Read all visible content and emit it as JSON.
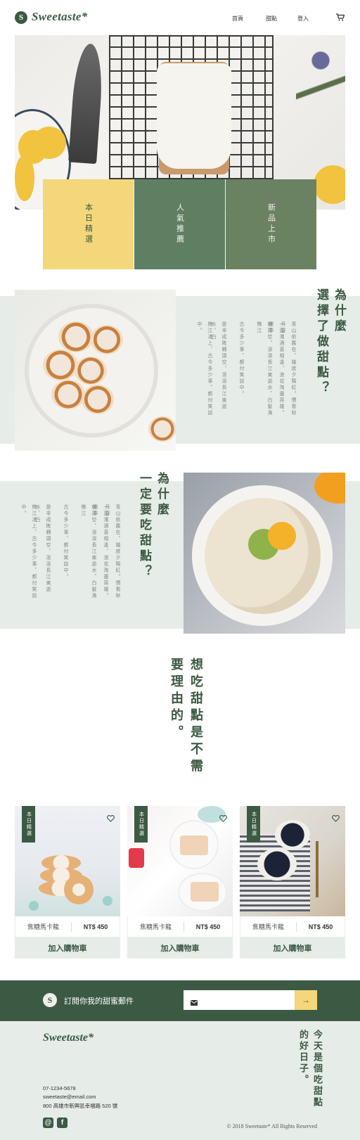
{
  "brand": {
    "name": "Sweetaste*",
    "mark": "S"
  },
  "nav": {
    "items": [
      "首頁",
      "甜點",
      "登入"
    ],
    "cart_icon": "cart-icon"
  },
  "categories": [
    "本日精選",
    "人氣推薦",
    "新品上市"
  ],
  "section_why_choose": {
    "title_lines": [
      "為什麼",
      "選擇了做甜點？"
    ],
    "body_lines": [
      "青山依舊在，幾度夕陽紅。慣看秋月春",
      "一壺濁酒喜相逢，浪花淘盡英雄。是非",
      "轉頭空，滾滾長江東逝水，白髮漁樵江",
      "古今多少事，都付笑談中。",
      "是非成敗轉頭空，滾滾長江東逝水，白",
      "樵江渚上，古今多少事，都付笑談中。"
    ]
  },
  "section_why_eat": {
    "title_lines": [
      "為什麼",
      "一定要吃甜點？"
    ],
    "body_lines": [
      "青山依舊在，幾度夕陽紅。慣看秋月春",
      "一壺濁酒喜相逢，浪花淘盡英雄。是非",
      "轉頭空，滾滾長江東逝水，白髮漁樵江",
      "古今多少事，都付笑談中。",
      "是非成敗轉頭空，滾滾長江東逝水，白",
      "樵江渚上，古今多少事，都付笑談中。"
    ]
  },
  "slogan": {
    "lines": [
      "想吃甜點",
      "是不需要理由的。"
    ]
  },
  "products": [
    {
      "badge": "本日精選",
      "name": "焦糖馬卡龍",
      "price": "NT$ 450",
      "cta": "加入購物車"
    },
    {
      "badge": "本日精選",
      "name": "焦糖馬卡龍",
      "price": "NT$ 450",
      "cta": "加入購物車"
    },
    {
      "badge": "本日精選",
      "name": "焦糖馬卡龍",
      "price": "NT$ 450",
      "cta": "加入購物車"
    }
  ],
  "newsletter": {
    "label": "訂閱你我的甜蜜郵件",
    "placeholder": "",
    "submit_icon": "arrow-right-icon"
  },
  "footer": {
    "logo": "Sweetaste*",
    "phone": "07-1234-5678",
    "email": "sweetaste@email.com",
    "address": "800 高雄市新興區幸福路 520 號",
    "slogan_lines": [
      "今天是個",
      "吃甜點的好日子。"
    ],
    "copyright": "© 2018 Sweetaste* All Rights Reserved"
  },
  "colors": {
    "primary": "#3c5a43",
    "accent": "#f3d77a",
    "band": "#e6ece8"
  }
}
